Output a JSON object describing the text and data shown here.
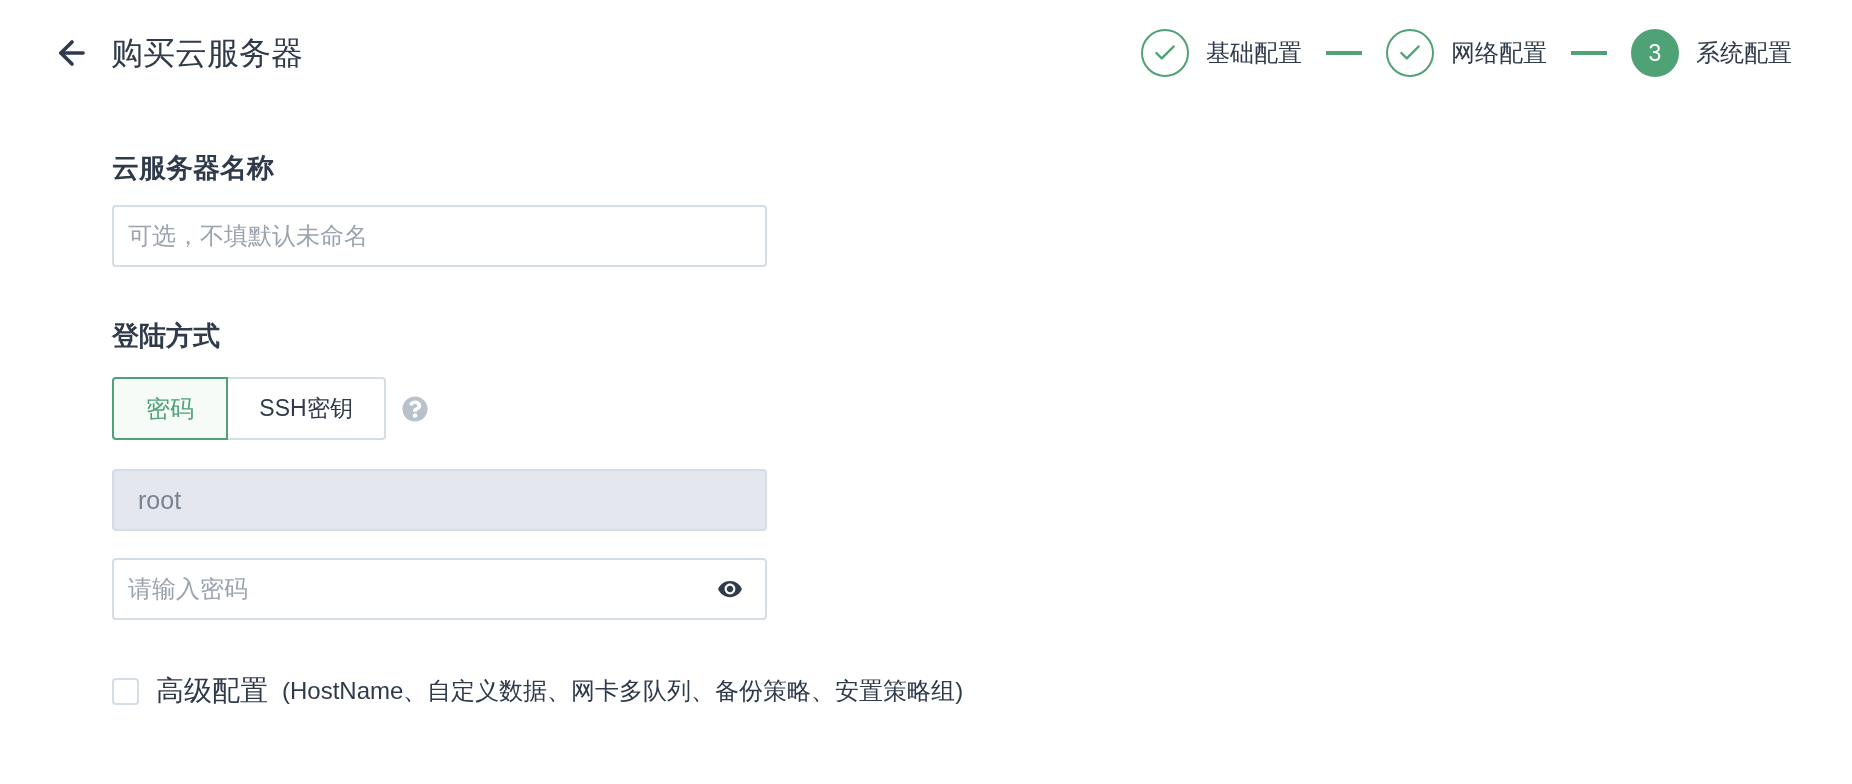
{
  "header": {
    "title": "购买云服务器"
  },
  "steps": [
    {
      "label": "基础配置",
      "completed": true
    },
    {
      "label": "网络配置",
      "completed": true
    },
    {
      "label": "系统配置",
      "completed": false,
      "number": "3"
    }
  ],
  "name_field": {
    "label": "云服务器名称",
    "placeholder": "可选，不填默认未命名"
  },
  "login": {
    "label": "登陆方式",
    "options": [
      {
        "label": "密码",
        "selected": true
      },
      {
        "label": "SSH密钥",
        "selected": false
      }
    ],
    "username": {
      "value": "root",
      "disabled": true
    },
    "password": {
      "placeholder": "请输入密码"
    }
  },
  "advanced": {
    "label": "高级配置",
    "checked": false,
    "hint": "(HostName、自定义数据、网卡多队列、备份策略、安置策略组)"
  }
}
